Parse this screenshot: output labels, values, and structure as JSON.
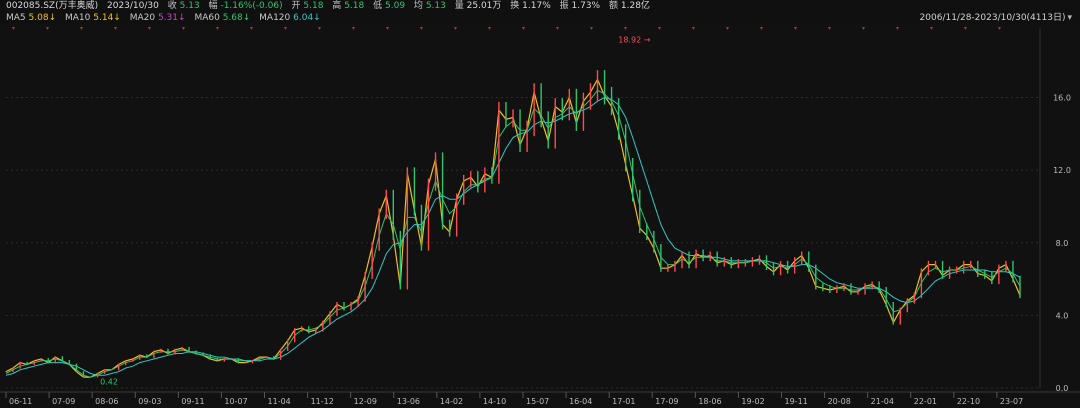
{
  "header": {
    "code": "002085.SZ(万丰奥威)",
    "date": "2023/10/30",
    "close_label": "收",
    "close": "5.13",
    "change_label": "幅",
    "change": "-1.16%(-0.06)",
    "open_label": "开",
    "open": "5.18",
    "high_label": "高",
    "high": "5.18",
    "low_label": "低",
    "low": "5.09",
    "avg_label": "均",
    "avg": "5.13",
    "volume_label": "量",
    "volume": "25.01万",
    "turnover_label": "换",
    "turnover": "1.17%",
    "amplitude_label": "振",
    "amplitude": "1.73%",
    "amount_label": "额",
    "amount": "1.28亿"
  },
  "ma_bar": {
    "ma5_label": "MA5",
    "ma5": "5.08↓",
    "ma10_label": "MA10",
    "ma10": "5.14↓",
    "ma20_label": "MA20",
    "ma20": "5.31↓",
    "ma60_label": "MA60",
    "ma60": "5.68↓",
    "ma120_label": "MA120",
    "ma120": "6.04↓",
    "date_range": "2006/11/28-2023/10/30(4113日)"
  },
  "colors": {
    "up": "#ff4b4b",
    "down": "#2ec46b",
    "ma5": "#f0c020",
    "ma10": "#f0c020",
    "ma20": "#d040d0",
    "ma60": "#2ec46b",
    "ma120": "#30c8c8"
  },
  "chart_data": {
    "type": "line",
    "y_axis_ticks": [
      "16.0",
      "12.0",
      "8.0",
      "4.0",
      "0.0"
    ],
    "ylim": [
      0,
      19.5
    ],
    "x_ticks": [
      "06-11",
      "07-09",
      "08-06",
      "09-03",
      "09-11",
      "10-07",
      "11-04",
      "11-12",
      "12-09",
      "13-06",
      "14-02",
      "14-10",
      "15-07",
      "16-04",
      "17-01",
      "17-09",
      "18-06",
      "19-02",
      "19-11",
      "20-08",
      "21-04",
      "22-01",
      "22-10",
      "23-07"
    ],
    "annotations": [
      {
        "text": "18.92",
        "x": "17-09",
        "y": 18.92
      },
      {
        "text": "0.42",
        "x": "08-06",
        "y": 0.42
      }
    ],
    "series": [
      {
        "key": "price",
        "values": [
          0.9,
          1.1,
          1.4,
          1.3,
          1.5,
          1.6,
          1.4,
          1.7,
          1.5,
          1.3,
          0.9,
          0.6,
          0.6,
          0.8,
          1.0,
          1.0,
          1.3,
          1.5,
          1.6,
          1.8,
          1.7,
          2.0,
          2.1,
          1.9,
          2.1,
          2.2,
          2.0,
          1.9,
          1.8,
          1.6,
          1.5,
          1.6,
          1.6,
          1.4,
          1.4,
          1.5,
          1.7,
          1.7,
          1.6,
          2.1,
          2.6,
          3.2,
          3.3,
          3.1,
          3.2,
          3.6,
          4.1,
          4.6,
          4.4,
          4.6,
          4.9,
          6.2,
          7.8,
          9.6,
          10.6,
          8.4,
          5.6,
          11.8,
          9.8,
          7.8,
          11.2,
          12.6,
          9.0,
          8.6,
          10.4,
          11.4,
          11.6,
          11.1,
          11.8,
          11.6,
          15.3,
          14.8,
          14.9,
          13.4,
          14.3,
          16.3,
          14.8,
          13.6,
          15.5,
          15.2,
          16.0,
          14.6,
          15.8,
          16.3,
          17.0,
          16.1,
          15.5,
          14.1,
          12.3,
          10.6,
          8.8,
          8.4,
          7.7,
          6.6,
          6.6,
          6.8,
          7.3,
          6.8,
          7.4,
          7.2,
          7.3,
          6.9,
          7.0,
          6.8,
          6.9,
          6.9,
          7.0,
          7.1,
          6.7,
          6.4,
          6.8,
          6.5,
          7.0,
          7.3,
          6.6,
          5.6,
          5.5,
          5.4,
          5.5,
          5.6,
          5.3,
          5.3,
          5.6,
          5.7,
          5.4,
          4.6,
          3.6,
          4.3,
          4.8,
          5.1,
          6.4,
          6.8,
          6.8,
          6.2,
          6.5,
          6.5,
          6.8,
          6.8,
          6.3,
          6.2,
          5.9,
          6.6,
          6.8,
          6.0,
          5.1
        ]
      },
      {
        "key": "ma_fast",
        "values": [
          0.8,
          1.0,
          1.2,
          1.3,
          1.4,
          1.5,
          1.5,
          1.6,
          1.5,
          1.3,
          1.0,
          0.7,
          0.6,
          0.7,
          0.9,
          1.0,
          1.2,
          1.4,
          1.5,
          1.7,
          1.7,
          1.9,
          2.0,
          2.0,
          2.0,
          2.1,
          2.0,
          1.9,
          1.8,
          1.7,
          1.6,
          1.6,
          1.6,
          1.5,
          1.5,
          1.5,
          1.6,
          1.7,
          1.6,
          1.9,
          2.3,
          2.9,
          3.2,
          3.2,
          3.3,
          3.5,
          3.9,
          4.3,
          4.4,
          4.6,
          4.8,
          5.6,
          6.8,
          8.4,
          9.6,
          9.0,
          7.6,
          9.4,
          9.4,
          8.6,
          10.2,
          11.4,
          10.4,
          9.6,
          10.0,
          10.8,
          11.2,
          11.2,
          11.5,
          11.6,
          13.8,
          14.4,
          14.7,
          14.2,
          14.2,
          15.4,
          15.0,
          14.3,
          14.9,
          15.1,
          15.5,
          15.1,
          15.5,
          15.9,
          16.4,
          16.2,
          15.8,
          15.0,
          13.6,
          11.8,
          10.0,
          9.0,
          8.2,
          7.2,
          6.8,
          6.8,
          7.1,
          6.9,
          7.2,
          7.2,
          7.2,
          7.0,
          7.0,
          6.9,
          6.9,
          6.9,
          7.0,
          7.0,
          6.9,
          6.6,
          6.7,
          6.6,
          6.8,
          7.1,
          6.8,
          6.1,
          5.8,
          5.6,
          5.5,
          5.5,
          5.4,
          5.4,
          5.5,
          5.6,
          5.5,
          4.9,
          4.2,
          4.3,
          4.7,
          5.0,
          5.8,
          6.4,
          6.6,
          6.4,
          6.5,
          6.5,
          6.6,
          6.7,
          6.5,
          6.3,
          6.1,
          6.4,
          6.6,
          6.3,
          5.6
        ]
      },
      {
        "key": "ma_slow",
        "values": [
          0.7,
          0.8,
          1.0,
          1.1,
          1.2,
          1.3,
          1.4,
          1.4,
          1.4,
          1.3,
          1.2,
          1.0,
          0.8,
          0.7,
          0.7,
          0.8,
          0.9,
          1.1,
          1.2,
          1.4,
          1.5,
          1.6,
          1.7,
          1.8,
          1.9,
          1.9,
          2.0,
          2.0,
          1.9,
          1.8,
          1.7,
          1.7,
          1.6,
          1.6,
          1.5,
          1.5,
          1.5,
          1.6,
          1.6,
          1.7,
          1.9,
          2.2,
          2.5,
          2.8,
          3.0,
          3.2,
          3.5,
          3.8,
          4.0,
          4.2,
          4.5,
          4.9,
          5.5,
          6.4,
          7.4,
          7.9,
          8.0,
          8.6,
          9.0,
          9.0,
          9.6,
          10.4,
          10.6,
          10.4,
          10.4,
          10.7,
          11.0,
          11.2,
          11.4,
          11.6,
          12.4,
          13.2,
          13.8,
          14.0,
          14.1,
          14.5,
          14.7,
          14.6,
          14.7,
          14.9,
          15.1,
          15.2,
          15.3,
          15.5,
          15.8,
          16.0,
          15.9,
          15.6,
          14.9,
          13.8,
          12.6,
          11.4,
          10.2,
          9.0,
          8.2,
          7.7,
          7.5,
          7.3,
          7.3,
          7.3,
          7.2,
          7.2,
          7.1,
          7.0,
          7.0,
          7.0,
          7.0,
          7.0,
          7.0,
          6.9,
          6.8,
          6.7,
          6.7,
          6.8,
          6.8,
          6.6,
          6.3,
          6.0,
          5.8,
          5.7,
          5.6,
          5.5,
          5.5,
          5.5,
          5.5,
          5.3,
          5.0,
          4.8,
          4.7,
          4.8,
          5.1,
          5.5,
          5.9,
          6.1,
          6.3,
          6.4,
          6.5,
          6.5,
          6.5,
          6.5,
          6.4,
          6.4,
          6.4,
          6.3,
          6.1
        ]
      }
    ]
  }
}
